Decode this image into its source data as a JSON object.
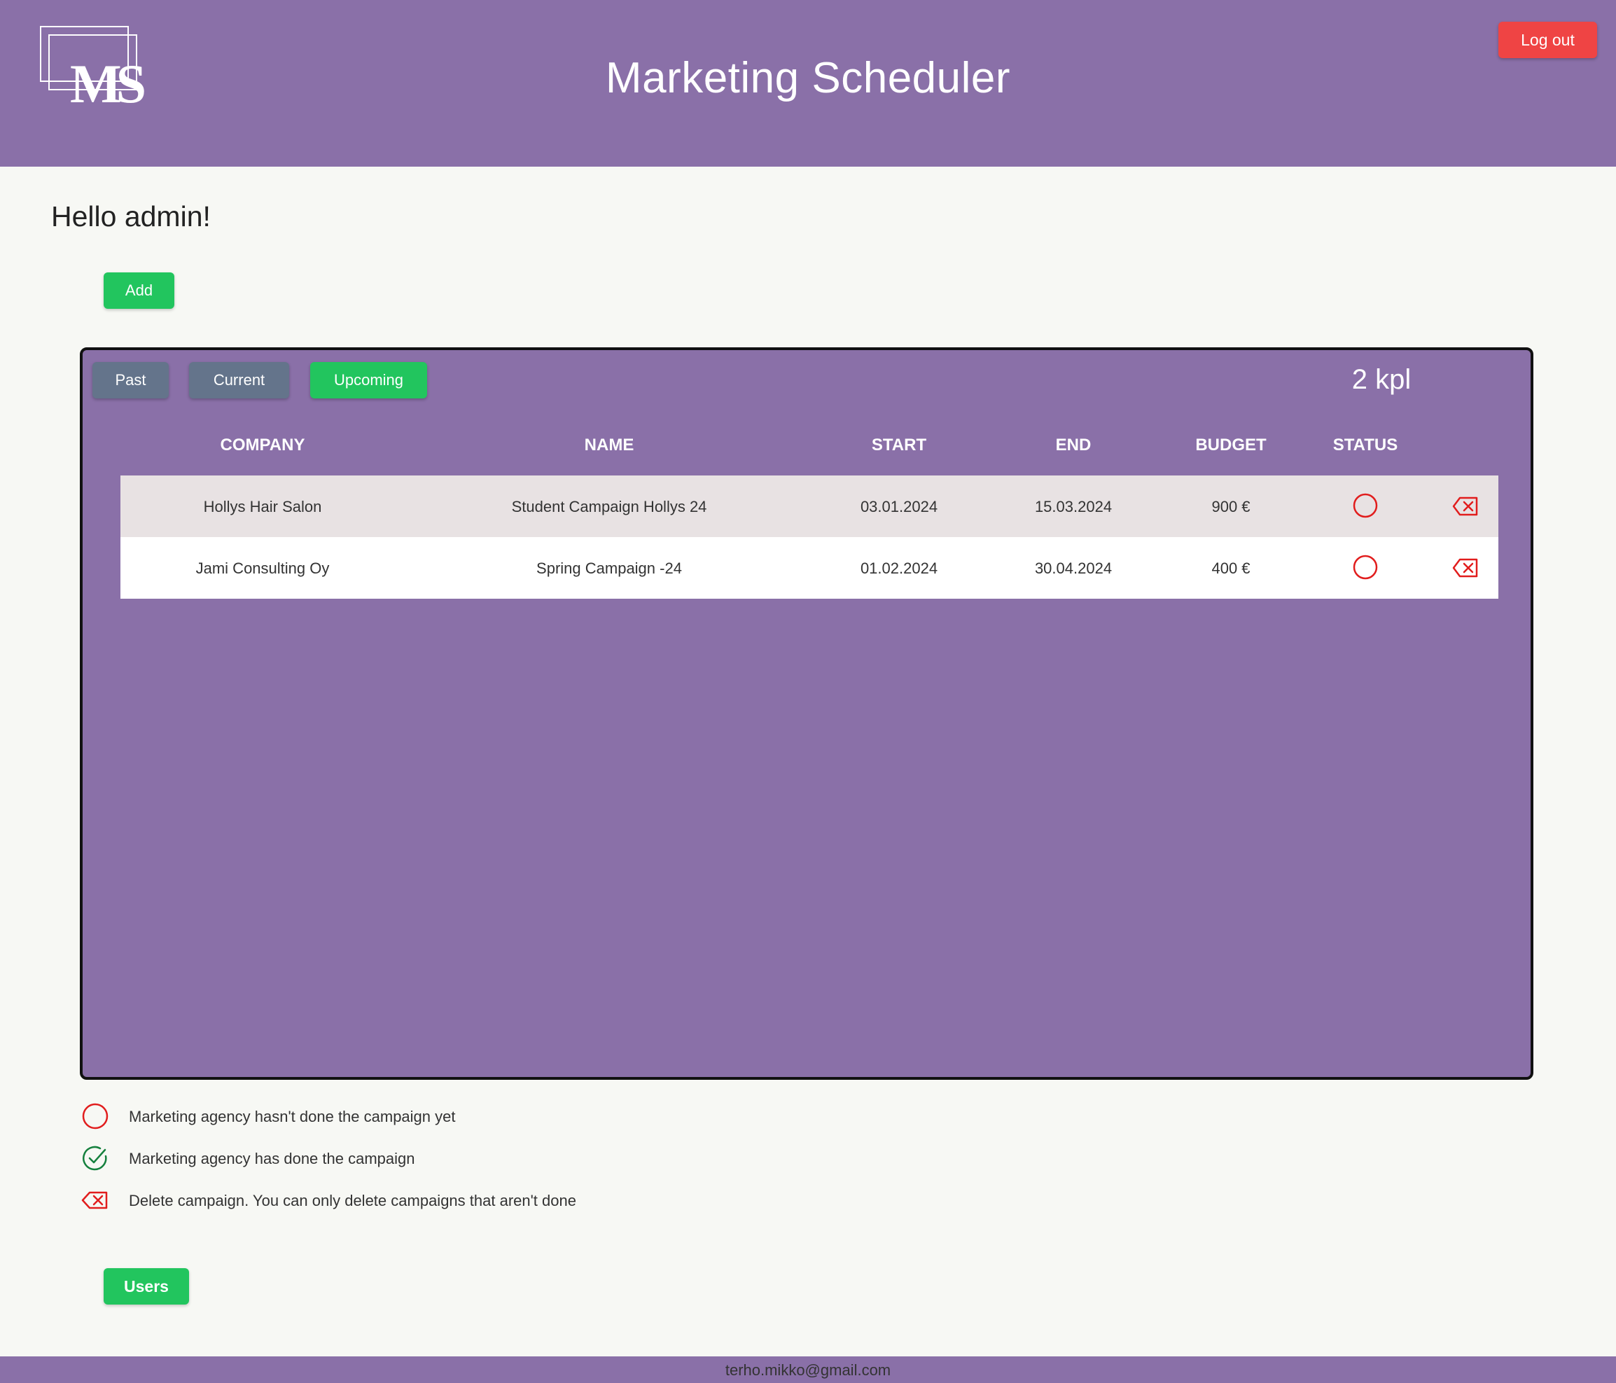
{
  "header": {
    "title": "Marketing Scheduler",
    "logout_label": "Log out",
    "logo_text": "MS"
  },
  "greeting": "Hello admin!",
  "add_label": "Add",
  "filters": {
    "past": "Past",
    "current": "Current",
    "upcoming": "Upcoming",
    "active": "Upcoming"
  },
  "count": "2 kpl",
  "table": {
    "columns": [
      "COMPANY",
      "NAME",
      "START",
      "END",
      "BUDGET",
      "STATUS"
    ],
    "rows": [
      {
        "company": "Hollys Hair Salon",
        "name": "Student Campaign Hollys 24",
        "start": "03.01.2024",
        "end": "15.03.2024",
        "budget": "900 €",
        "status": "not-done-icon",
        "action": "delete-icon"
      },
      {
        "company": "Jami Consulting Oy",
        "name": "Spring Campaign -24",
        "start": "01.02.2024",
        "end": "30.04.2024",
        "budget": "400 €",
        "status": "not-done-icon",
        "action": "delete-icon"
      }
    ]
  },
  "legend": {
    "not_done": "Marketing agency hasn't done the campaign yet",
    "done": "Marketing agency has done the campaign",
    "delete": "Delete campaign. You can only delete campaigns that aren't done"
  },
  "users_label": "Users",
  "footer": {
    "email": "terho.mikko@gmail.com"
  },
  "colors": {
    "brand_purple": "#8a70a8",
    "green": "#22c55e",
    "red": "#ef4444",
    "gray_button": "#64748b",
    "status_red": "#e11d1d",
    "status_green": "#15803d"
  }
}
